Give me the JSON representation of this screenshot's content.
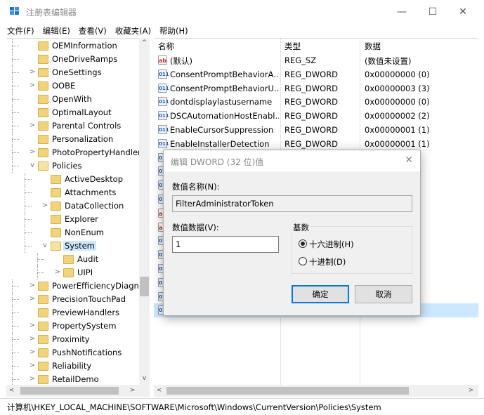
{
  "window": {
    "title": "注册表编辑器",
    "minimize": "—",
    "maximize": "☐",
    "close": "✕"
  },
  "menu": [
    "文件(F)",
    "编辑(E)",
    "查看(V)",
    "收藏夹(A)",
    "帮助(H)"
  ],
  "tree": {
    "items": [
      {
        "label": "OEMInformation",
        "level": 1,
        "expander": ""
      },
      {
        "label": "OneDriveRamps",
        "level": 1,
        "expander": ""
      },
      {
        "label": "OneSettings",
        "level": 1,
        "expander": ">"
      },
      {
        "label": "OOBE",
        "level": 1,
        "expander": ">"
      },
      {
        "label": "OpenWith",
        "level": 1,
        "expander": ""
      },
      {
        "label": "OptimalLayout",
        "level": 1,
        "expander": ""
      },
      {
        "label": "Parental Controls",
        "level": 1,
        "expander": ">"
      },
      {
        "label": "Personalization",
        "level": 1,
        "expander": ""
      },
      {
        "label": "PhotoPropertyHandler",
        "level": 1,
        "expander": ">"
      },
      {
        "label": "Policies",
        "level": 1,
        "expander": "v",
        "open": true
      },
      {
        "label": "ActiveDesktop",
        "level": 2,
        "expander": ""
      },
      {
        "label": "Attachments",
        "level": 2,
        "expander": ""
      },
      {
        "label": "DataCollection",
        "level": 2,
        "expander": ">"
      },
      {
        "label": "Explorer",
        "level": 2,
        "expander": ""
      },
      {
        "label": "NonEnum",
        "level": 2,
        "expander": ""
      },
      {
        "label": "System",
        "level": 2,
        "expander": "v",
        "open": true,
        "selected": true
      },
      {
        "label": "Audit",
        "level": 3,
        "expander": ""
      },
      {
        "label": "UIPI",
        "level": 3,
        "expander": ">"
      },
      {
        "label": "PowerEfficiencyDiagnc",
        "level": 1,
        "expander": ">"
      },
      {
        "label": "PrecisionTouchPad",
        "level": 1,
        "expander": ">"
      },
      {
        "label": "PreviewHandlers",
        "level": 1,
        "expander": ""
      },
      {
        "label": "PropertySystem",
        "level": 1,
        "expander": ">"
      },
      {
        "label": "Proximity",
        "level": 1,
        "expander": ">"
      },
      {
        "label": "PushNotifications",
        "level": 1,
        "expander": ">"
      },
      {
        "label": "Reliability",
        "level": 1,
        "expander": ">"
      },
      {
        "label": "RetailDemo",
        "level": 1,
        "expander": ">"
      }
    ],
    "scroll_up": "^",
    "scroll_down": "v",
    "scroll_left": "<",
    "scroll_right": ">"
  },
  "list": {
    "headers": {
      "name": "名称",
      "type": "类型",
      "data": "数据"
    },
    "rows": [
      {
        "icon": "ab",
        "kind": "sz",
        "name": "(默认)",
        "type": "REG_SZ",
        "data": "(数值未设置)"
      },
      {
        "icon": "011",
        "kind": "dw",
        "name": "ConsentPromptBehaviorA...",
        "type": "REG_DWORD",
        "data": "0x00000000 (0)"
      },
      {
        "icon": "011",
        "kind": "dw",
        "name": "ConsentPromptBehaviorU...",
        "type": "REG_DWORD",
        "data": "0x00000003 (3)"
      },
      {
        "icon": "011",
        "kind": "dw",
        "name": "dontdisplaylastusername",
        "type": "REG_DWORD",
        "data": "0x00000000 (0)"
      },
      {
        "icon": "011",
        "kind": "dw",
        "name": "DSCAutomationHostEnabl...",
        "type": "REG_DWORD",
        "data": "0x00000002 (2)"
      },
      {
        "icon": "011",
        "kind": "dw",
        "name": "EnableCursorSuppression",
        "type": "REG_DWORD",
        "data": "0x00000001 (1)"
      },
      {
        "icon": "011",
        "kind": "dw",
        "name": "EnableInstallerDetection",
        "type": "REG_DWORD",
        "data": "0x00000001 (1)"
      },
      {
        "icon": "011",
        "kind": "dw",
        "name": "",
        "type": "",
        "data": ")"
      },
      {
        "icon": "011",
        "kind": "dw",
        "name": "",
        "type": "",
        "data": ")"
      },
      {
        "icon": "011",
        "kind": "dw",
        "name": "",
        "type": "",
        "data": ")"
      },
      {
        "icon": "011",
        "kind": "dw",
        "name": "",
        "type": "",
        "data": ")"
      },
      {
        "icon": "ab",
        "kind": "sz",
        "name": "",
        "type": "",
        "data": ""
      },
      {
        "icon": "ab",
        "kind": "sz",
        "name": "",
        "type": "",
        "data": ""
      },
      {
        "icon": "011",
        "kind": "dw",
        "name": "",
        "type": "",
        "data": ")"
      },
      {
        "icon": "011",
        "kind": "dw",
        "name": "",
        "type": "",
        "data": ")"
      },
      {
        "icon": "011",
        "kind": "dw",
        "name": "",
        "type": "",
        "data": ")"
      },
      {
        "icon": "011",
        "kind": "dw",
        "name": "",
        "type": "",
        "data": ")"
      },
      {
        "icon": "011",
        "kind": "dw",
        "name": "",
        "type": "",
        "data": ")"
      },
      {
        "icon": "011",
        "kind": "dw",
        "name": "",
        "type": "",
        "data": ")",
        "highlight": true
      }
    ],
    "scroll_left": "<",
    "scroll_right": ">"
  },
  "status": {
    "path": "计算机\\HKEY_LOCAL_MACHINE\\SOFTWARE\\Microsoft\\Windows\\CurrentVersion\\Policies\\System"
  },
  "dialog": {
    "title": "编辑 DWORD (32 位)值",
    "close": "✕",
    "name_label": "数值名称(N):",
    "name_value": "FilterAdministratorToken",
    "data_label": "数值数据(V):",
    "data_value": "1",
    "base_label": "基数",
    "hex_label": "十六进制(H)",
    "dec_label": "十进制(D)",
    "ok": "确定",
    "cancel": "取消"
  },
  "colors": {
    "selection": "#cce8ff",
    "accent": "#0078d7",
    "folder": "#f1d37c"
  }
}
